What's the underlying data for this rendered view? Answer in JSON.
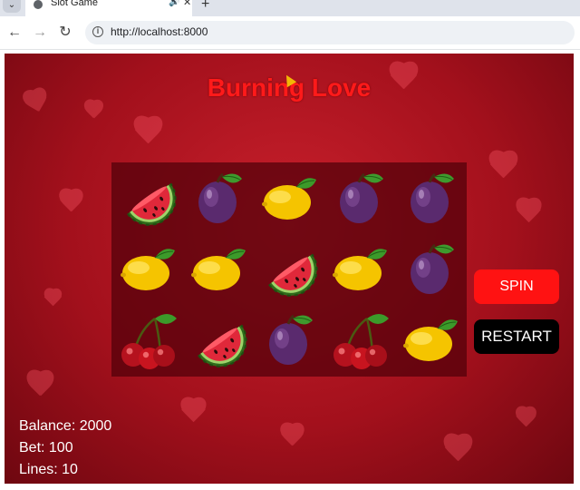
{
  "browser": {
    "tab_title": "Slot Game",
    "url": "http://localhost:8000"
  },
  "game": {
    "title": "Burning Love",
    "buttons": {
      "spin": "SPIN",
      "restart": "RESTART"
    },
    "stats": {
      "balance_text": "Balance: 2000",
      "bet_text": "Bet: 100",
      "lines_text": "Lines: 10"
    },
    "reels": [
      [
        "watermelon",
        "plum",
        "lemon",
        "plum",
        "plum"
      ],
      [
        "lemon",
        "lemon",
        "watermelon",
        "lemon",
        "plum"
      ],
      [
        "cherry",
        "watermelon",
        "plum",
        "cherry",
        "lemon"
      ]
    ]
  }
}
